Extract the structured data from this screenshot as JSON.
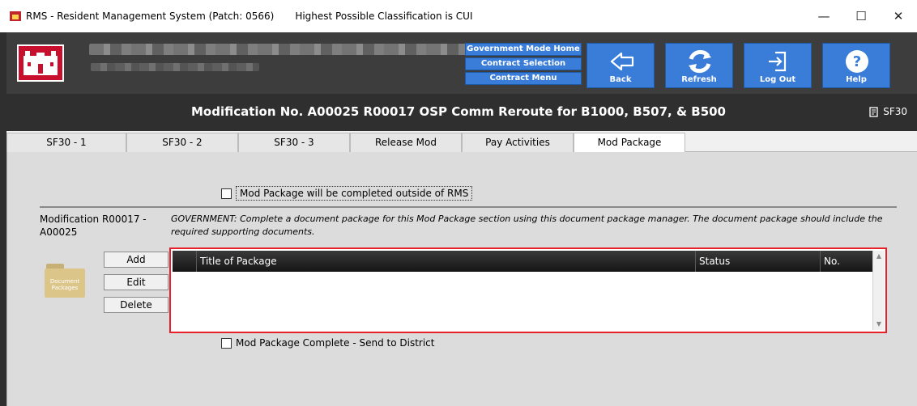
{
  "window": {
    "title": "RMS - Resident Management System (Patch: 0566)",
    "classification": "Highest Possible Classification is CUI",
    "controls": {
      "minimize": "—",
      "maximize": "☐",
      "close": "✕"
    }
  },
  "header": {
    "nav_buttons": [
      "Government Mode Home",
      "Contract Selection",
      "Contract Menu"
    ],
    "actions": {
      "back": "Back",
      "refresh": "Refresh",
      "logout": "Log Out",
      "help": "Help"
    }
  },
  "banner": {
    "title": "Modification No. A00025 R00017 OSP Comm Reroute for B1000, B507, & B500",
    "sf30": "SF30"
  },
  "tabs": [
    "SF30 - 1",
    "SF30 - 2",
    "SF30 - 3",
    "Release Mod",
    "Pay Activities",
    "Mod Package"
  ],
  "mod_package": {
    "outside_rms_label": "Mod Package will be completed outside of RMS",
    "modification_label": "Modification R00017 - A00025",
    "instructions": "GOVERNMENT: Complete a document package for this Mod Package section using this document package manager. The document package should include the required supporting documents.",
    "folder_label": "Document Packages",
    "buttons": {
      "add": "Add",
      "edit": "Edit",
      "delete": "Delete"
    },
    "grid_columns": [
      "Title of Package",
      "Status",
      "No."
    ],
    "complete_label": "Mod Package Complete - Send to District"
  },
  "colors": {
    "accent_blue": "#3a7dd8",
    "header_dark": "#3d3d3d",
    "highlight_red": "#e8202a"
  }
}
